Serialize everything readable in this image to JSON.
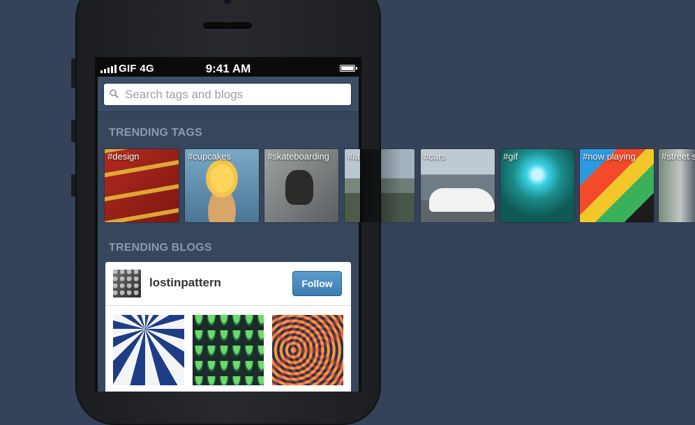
{
  "status_bar": {
    "carrier": "GIF 4G",
    "time": "9:41 AM"
  },
  "search": {
    "placeholder": "Search tags and blogs"
  },
  "trending_tags": {
    "title": "TRENDING TAGS",
    "tags": [
      {
        "label": "#design"
      },
      {
        "label": "#cupcakes"
      },
      {
        "label": "#skateboarding"
      },
      {
        "label": "#landscape"
      },
      {
        "label": "#cars"
      },
      {
        "label": "#gif"
      },
      {
        "label": "#now playing"
      },
      {
        "label": "#street style"
      }
    ]
  },
  "trending_blogs": {
    "title": "TRENDING BLOGS",
    "blog": {
      "name": "lostinpattern",
      "follow_label": "Follow"
    }
  },
  "colors": {
    "background": "#34435a",
    "app_background": "#36465d",
    "follow_button": "#3b7db0"
  }
}
